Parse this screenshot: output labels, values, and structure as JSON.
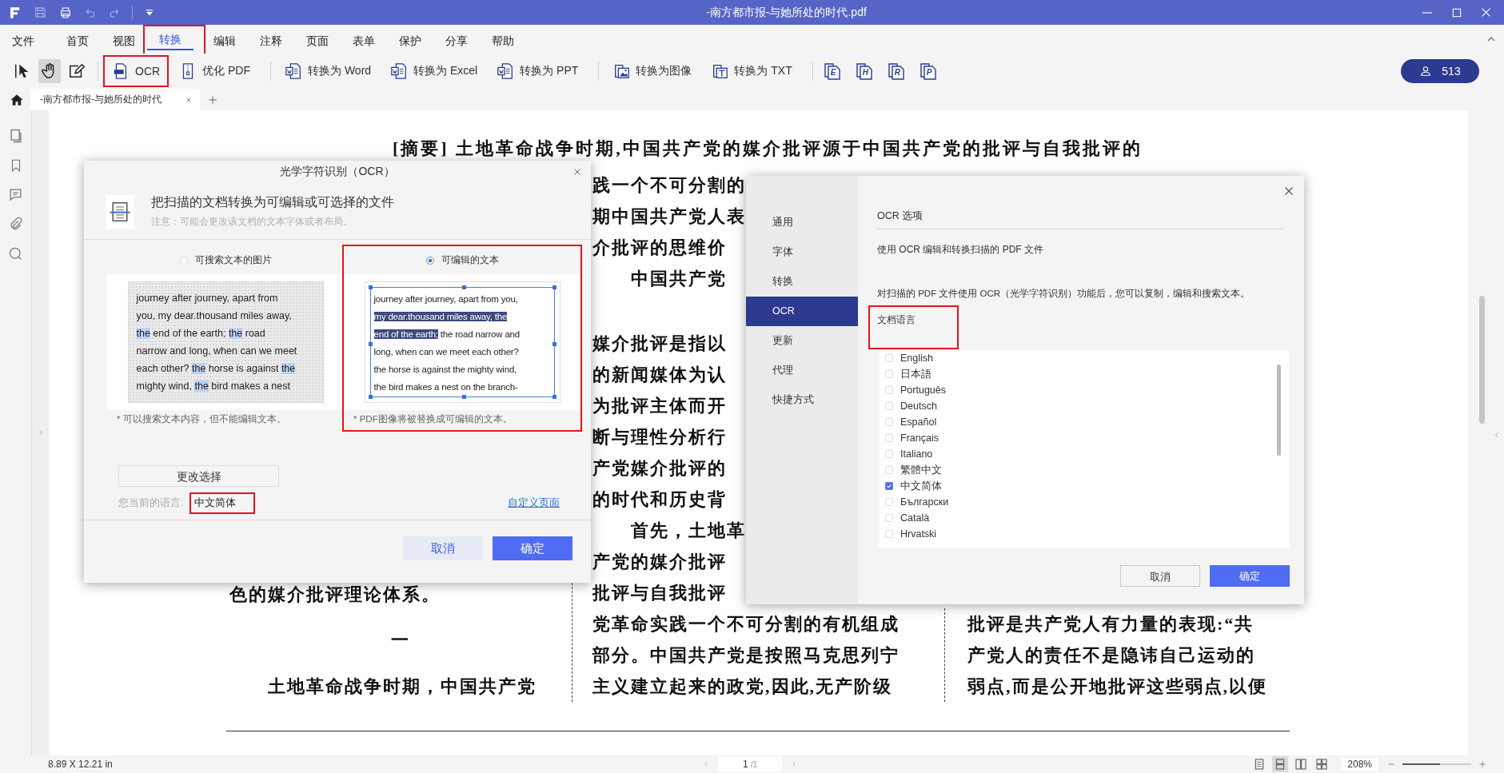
{
  "window": {
    "title": "-南方都市报-与她所处的时代.pdf"
  },
  "menu": [
    {
      "label": "文件",
      "selected": false,
      "annotated": false
    },
    {
      "label": "首页",
      "selected": false,
      "annotated": false
    },
    {
      "label": "视图",
      "selected": false,
      "annotated": false
    },
    {
      "label": "转换",
      "selected": true,
      "annotated": true
    },
    {
      "label": "编辑",
      "selected": false,
      "annotated": false
    },
    {
      "label": "注释",
      "selected": false,
      "annotated": false
    },
    {
      "label": "页面",
      "selected": false,
      "annotated": false
    },
    {
      "label": "表单",
      "selected": false,
      "annotated": false
    },
    {
      "label": "保护",
      "selected": false,
      "annotated": false
    },
    {
      "label": "分享",
      "selected": false,
      "annotated": false
    },
    {
      "label": "帮助",
      "selected": false,
      "annotated": false
    }
  ],
  "toolbar": {
    "tools": [
      {
        "selected": false
      },
      {
        "selected": true
      },
      {
        "selected": false
      }
    ],
    "buttons": [
      {
        "label": "OCR",
        "annotated": true
      },
      {
        "label": "优化 PDF",
        "annotated": false
      },
      {
        "label": "转换为 Word",
        "annotated": false
      },
      {
        "label": "转换为 Excel",
        "annotated": false
      },
      {
        "label": "转换为 PPT",
        "annotated": false
      },
      {
        "label": "转换为图像",
        "annotated": false
      },
      {
        "label": "转换为 TXT",
        "annotated": false
      }
    ],
    "export_buttons": [
      "E",
      "H",
      "R",
      "P"
    ],
    "user_count": "513"
  },
  "tabs": [
    {
      "label": "-南方都市报-与她所处的时代",
      "selected": true
    }
  ],
  "document": {
    "abstract": "[摘要] 土地革命战争时期,中国共产党的媒介批评源于中国共产党的批评与自我批评的",
    "left_column": [
      {
        "text": "色的媒介批评理论体系。",
        "kind": "line"
      },
      {
        "text": "一",
        "kind": "section"
      },
      {
        "text": "土地革命战争时期，中国共产党",
        "kind": "indent"
      }
    ],
    "middle_column": [
      [
        {
          "text": "践一个不可分割的",
          "kind": "line"
        },
        {
          "text": "期中国共产党人表",
          "kind": "line"
        },
        {
          "text": "介批评的思维价",
          "kind": "line"
        },
        {
          "text": "中国共产党",
          "kind": "indent"
        }
      ],
      [
        {
          "text": "媒介批评是指以",
          "kind": "line"
        },
        {
          "text": "的新闻媒体为认",
          "kind": "line"
        },
        {
          "text": "为批评主体而开",
          "kind": "line"
        },
        {
          "text": "断与理性分析行",
          "kind": "line"
        },
        {
          "text": "产党媒介批评的",
          "kind": "line"
        },
        {
          "text": "的时代和历史背",
          "kind": "line"
        },
        {
          "text": "首先，土地革",
          "kind": "indent"
        },
        {
          "text": "产党的媒介批评",
          "kind": "line"
        },
        {
          "text": "批评与自我批评",
          "kind": "line"
        },
        {
          "text": "党革命实践一个不可分割的有机组成",
          "kind": "line"
        },
        {
          "text": "部分。中国共产党是按照马克思列宁",
          "kind": "line"
        },
        {
          "text": "主义建立起来的政党,因此,无产阶级",
          "kind": "line"
        }
      ]
    ],
    "right_column": [
      {
        "text": "批评是共产党人有力量的表现:“共",
        "kind": "line"
      },
      {
        "text": "产党人的责任不是隐讳自己运动的",
        "kind": "line"
      },
      {
        "text": "弱点,而是公开地批评这些弱点,以便",
        "kind": "line"
      }
    ]
  },
  "ocr_dialog": {
    "title": "光学字符识别（OCR）",
    "heading": "把扫描的文档转换为可编辑或可选择的文件",
    "note": "注意：可能会更改该文档的文本字体或者布局。",
    "options": [
      {
        "label": "可搜索文本的图片",
        "selected": false,
        "annotated": false,
        "kind": "scanned",
        "caption": "* 可以搜索文本内容，但不能编辑文本。",
        "lines": [
          [
            {
              "text": "journey after journey, apart from",
              "highlighted": false
            }
          ],
          [
            {
              "text": "you, my dear.thousand miles away,",
              "highlighted": false
            }
          ],
          [
            {
              "text": "the",
              "highlighted": true
            },
            {
              "text": " end of the earth; ",
              "highlighted": false
            },
            {
              "text": "the",
              "highlighted": true
            },
            {
              "text": " road",
              "highlighted": false
            }
          ],
          [
            {
              "text": "narrow and long, when can we meet",
              "highlighted": false
            }
          ],
          [
            {
              "text": "each other? ",
              "highlighted": false
            },
            {
              "text": "the",
              "highlighted": true
            },
            {
              "text": " horse is against ",
              "highlighted": false
            },
            {
              "text": "the",
              "highlighted": true
            }
          ],
          [
            {
              "text": "mighty wind, ",
              "highlighted": false
            },
            {
              "text": "the",
              "highlighted": true
            },
            {
              "text": " bird makes a nest",
              "highlighted": false
            }
          ]
        ]
      },
      {
        "label": "可编辑的文本",
        "selected": true,
        "annotated": true,
        "kind": "editable",
        "caption": "* PDF图像将被替换成可编辑的文本。",
        "lines": [
          [
            {
              "text": "journey after journey, apart from you,",
              "highlighted": false
            }
          ],
          [
            {
              "text": "my dear.thousand miles away, the",
              "highlighted": true
            }
          ],
          [
            {
              "text": "end of the earth;",
              "highlighted": true
            },
            {
              "text": " the road narrow and",
              "highlighted": false
            }
          ],
          [
            {
              "text": "long, when can we meet each other?",
              "highlighted": false
            }
          ],
          [
            {
              "text": "the horse is against the mighty wind,",
              "highlighted": false
            }
          ],
          [
            {
              "text": "the bird makes a nest on the branch-",
              "highlighted": false
            }
          ]
        ]
      }
    ],
    "change_button": "更改选择",
    "language_label": "您当前的语言:",
    "language": {
      "value": "中文简体",
      "annotated": true
    },
    "custom_link": "自定义页面",
    "buttons": [
      {
        "label": "取消",
        "kind": "secondary"
      },
      {
        "label": "确定",
        "kind": "primary"
      }
    ]
  },
  "options_dialog": {
    "nav": [
      {
        "label": "通用",
        "selected": false
      },
      {
        "label": "字体",
        "selected": false
      },
      {
        "label": "转换",
        "selected": false
      },
      {
        "label": "OCR",
        "selected": true
      },
      {
        "label": "更新",
        "selected": false
      },
      {
        "label": "代理",
        "selected": false
      },
      {
        "label": "快捷方式",
        "selected": false
      }
    ],
    "section_title": "OCR 选项",
    "subtitle": "使用 OCR 编辑和转换扫描的 PDF 文件",
    "description": "对扫描的 PDF 文件使用 OCR（光学字符识别）功能后，您可以复制，编辑和搜索文本。",
    "language_heading": {
      "text": "文档语言",
      "annotated": true
    },
    "languages": [
      {
        "name": "English",
        "checked": false
      },
      {
        "name": "日本語",
        "checked": false
      },
      {
        "name": "Português",
        "checked": false
      },
      {
        "name": "Deutsch",
        "checked": false
      },
      {
        "name": "Español",
        "checked": false
      },
      {
        "name": "Français",
        "checked": false
      },
      {
        "name": "Italiano",
        "checked": false
      },
      {
        "name": "繁體中文",
        "checked": false
      },
      {
        "name": "中文简体",
        "checked": true
      },
      {
        "name": "Български",
        "checked": false
      },
      {
        "name": "Català",
        "checked": false
      },
      {
        "name": "Hrvatski",
        "checked": false
      }
    ],
    "buttons": [
      {
        "label": "取消",
        "kind": "secondary"
      },
      {
        "label": "确定",
        "kind": "primary"
      }
    ]
  },
  "status_bar": {
    "page_size": "8.89 X 12.21 in",
    "page": "1",
    "page_total": "/1",
    "views": [
      {
        "selected": false
      },
      {
        "selected": true
      },
      {
        "selected": false
      },
      {
        "selected": false
      }
    ],
    "zoom": "208%",
    "zoom_slider": {
      "level": 0.55
    }
  }
}
